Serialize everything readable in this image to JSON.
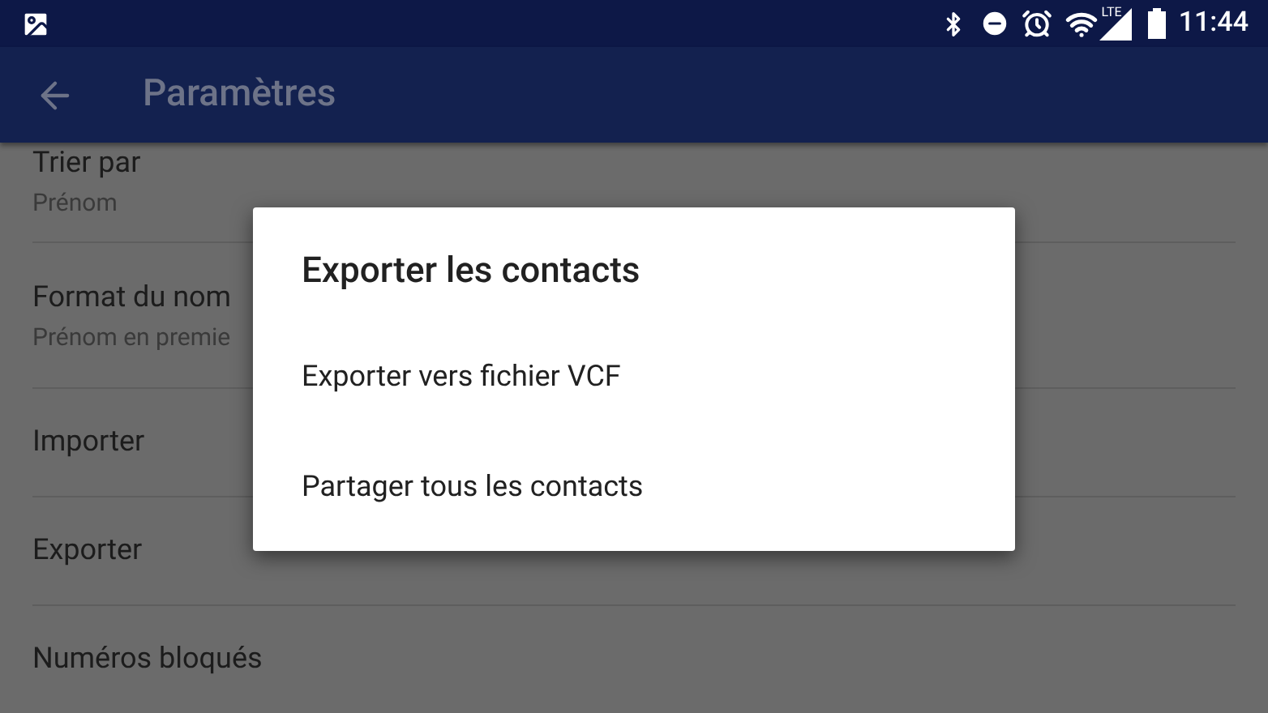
{
  "status_bar": {
    "network_label": "LTE",
    "time": "11:44"
  },
  "app_bar": {
    "title": "Paramètres"
  },
  "settings": [
    {
      "title": "Trier par",
      "subtitle": "Prénom"
    },
    {
      "title": "Format du nom",
      "subtitle": "Prénom en premie"
    },
    {
      "title": "Importer"
    },
    {
      "title": "Exporter"
    },
    {
      "title": "Numéros bloqués"
    }
  ],
  "dialog": {
    "title": "Exporter les contacts",
    "options": [
      "Exporter vers fichier VCF",
      "Partager tous les contacts"
    ]
  }
}
